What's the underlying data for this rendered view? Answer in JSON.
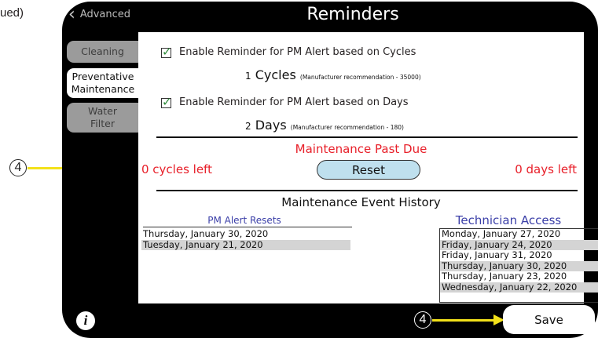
{
  "page_note": "ued)",
  "header": {
    "back_label": "Advanced",
    "title": "Reminders"
  },
  "tabs": [
    {
      "label": "Cleaning"
    },
    {
      "label": "Preventative Maintenance"
    },
    {
      "label": "Water Filter"
    }
  ],
  "cycles_reminder": {
    "checked": true,
    "label": "Enable Reminder for PM Alert based on Cycles",
    "value": "1",
    "unit": "Cycles",
    "recommendation": "(Manufacturer recommendation - 35000)"
  },
  "days_reminder": {
    "checked": true,
    "label": "Enable Reminder for PM Alert based on Days",
    "value": "2",
    "unit": "Days",
    "recommendation": "(Manufacturer recommendation - 180)"
  },
  "status": {
    "heading": "Maintenance Past Due",
    "cycles_left": "0 cycles left",
    "days_left": "0 days left",
    "reset_label": "Reset"
  },
  "history": {
    "title": "Maintenance Event History",
    "pm_alert_resets": {
      "header": "PM Alert Resets",
      "rows": [
        "Thursday, January 30, 2020",
        "Tuesday, January 21, 2020"
      ]
    },
    "technician_access": {
      "header": "Technician Access",
      "rows": [
        "Monday, January 27, 2020",
        "Friday, January 24, 2020",
        "Friday, January 31, 2020",
        "Thursday, January 30, 2020",
        "Thursday, January 23, 2020",
        "Wednesday, January 22, 2020"
      ]
    }
  },
  "footer": {
    "info_label": "i",
    "save_label": "Save"
  },
  "callouts": {
    "number": "4"
  },
  "colors": {
    "arrow": "#f3e11a",
    "alert_red": "#e8202a",
    "reset_fill": "#bfe0ee",
    "header_blue": "#3b3fa8"
  }
}
